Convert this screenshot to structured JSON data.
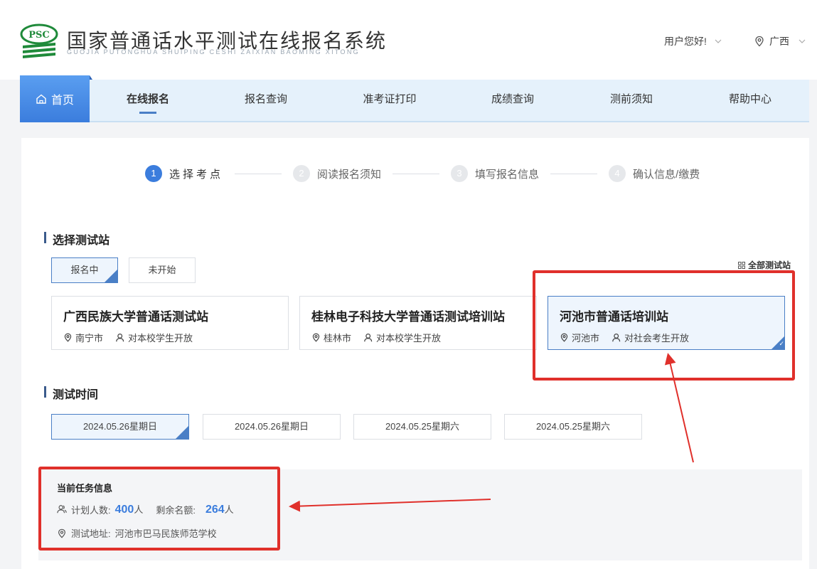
{
  "header": {
    "logo_text": "PSC",
    "title_cn": "国家普通话水平测试在线报名系统",
    "title_en": "GUOJIA PUTONGHUA SHUIPING CESHI ZAIXIAN BAOMING XITONG",
    "user_greeting": "用户您好!",
    "region": "广西"
  },
  "nav": {
    "home": "首页",
    "items": [
      "在线报名",
      "报名查询",
      "准考证打印",
      "成绩查询",
      "测前须知",
      "帮助中心"
    ],
    "active_index": 0
  },
  "steps": [
    {
      "num": "1",
      "label": "选择考点",
      "active": true
    },
    {
      "num": "2",
      "label": "阅读报名须知",
      "active": false
    },
    {
      "num": "3",
      "label": "填写报名信息",
      "active": false
    },
    {
      "num": "4",
      "label": "确认信息/缴费",
      "active": false
    }
  ],
  "site_section": {
    "title": "选择测试站",
    "tabs": [
      {
        "label": "报名中",
        "selected": true
      },
      {
        "label": "未开始",
        "selected": false
      }
    ],
    "all_sites_link": "全部测试站",
    "sites": [
      {
        "name": "广西民族大学普通话测试站",
        "city": "南宁市",
        "audience": "对本校学生开放",
        "selected": false
      },
      {
        "name": "桂林电子科技大学普通话测试培训站",
        "city": "桂林市",
        "audience": "对本校学生开放",
        "selected": false
      },
      {
        "name": "河池市普通话培训站",
        "city": "河池市",
        "audience": "对社会考生开放",
        "selected": true
      }
    ]
  },
  "time_section": {
    "title": "测试时间",
    "slots": [
      {
        "label": "2024.05.26星期日",
        "selected": true
      },
      {
        "label": "2024.05.26星期日",
        "selected": false
      },
      {
        "label": "2024.05.25星期六",
        "selected": false
      },
      {
        "label": "2024.05.25星期六",
        "selected": false
      }
    ]
  },
  "task_info": {
    "title": "当前任务信息",
    "planned_label": "计划人数:",
    "planned_value": "400",
    "planned_unit": "人",
    "remaining_label": "剩余名额:",
    "remaining_value": "264",
    "remaining_unit": "人",
    "address_label": "测试地址:",
    "address_value": "河池市巴马民族师范学校"
  },
  "colors": {
    "accent": "#3b7ddd",
    "annotation": "#e0302b",
    "nav_bg": "#e5f1fb"
  }
}
